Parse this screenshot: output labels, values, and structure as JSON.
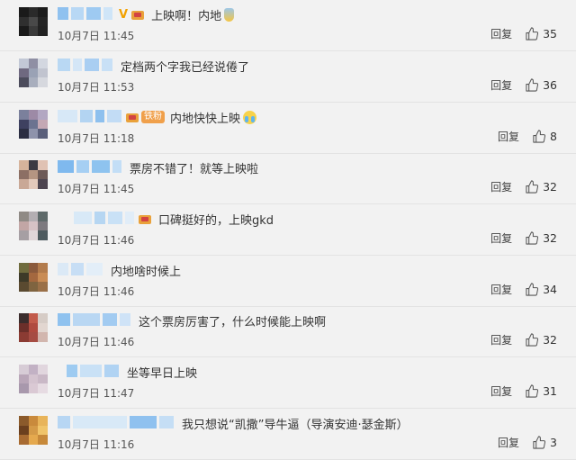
{
  "comments": [
    {
      "text": "上映啊！内地",
      "time": "10月7日 11:45",
      "reply_label": "回复",
      "likes": "35",
      "has_vip": true,
      "vip_label": "V",
      "emoji": "bottle-emoji",
      "avatar_colors": [
        "#1a1a1a",
        "#2a2a2a",
        "#1c1c1c",
        "#2f2f2f",
        "#494949",
        "#242424",
        "#1a1a1a",
        "#3a3a3a",
        "#222222"
      ],
      "blur_colors": [
        "#8fc1ef",
        "#b8d8f5",
        "#9ecaf2",
        "#cfe5f8"
      ]
    },
    {
      "text": "定档两个字我已经说倦了",
      "time": "10月7日 11:53",
      "reply_label": "回复",
      "likes": "36",
      "avatar_colors": [
        "#c2c8d6",
        "#8f8fa4",
        "#d3d7e0",
        "#6f6980",
        "#9aa2b5",
        "#c1c4cf",
        "#4c4c5c",
        "#a8aebd",
        "#d6d8de"
      ],
      "blur_colors": [
        "#b9d8f3",
        "#d4e6f7",
        "#a9cef2",
        "#c8e0f6"
      ]
    },
    {
      "text": "内地快快上映",
      "time": "10月7日 11:18",
      "reply_label": "回复",
      "likes": "8",
      "fan_label": "铁粉",
      "emoji": "cry-emoji",
      "avatar_colors": [
        "#7b809c",
        "#9d8aa6",
        "#b2a7c2",
        "#3e4160",
        "#6c7390",
        "#c4a8b4",
        "#2b2e42",
        "#8e93ab",
        "#5a5f7a"
      ],
      "blur_colors": [
        "#d7e8f7",
        "#b3d4f2",
        "#8ec0ee",
        "#c2dcf5"
      ]
    },
    {
      "text": "票房不错了！就等上映啦",
      "time": "10月7日 11:45",
      "reply_label": "回复",
      "likes": "32",
      "avatar_colors": [
        "#d6b39b",
        "#3d3a42",
        "#e0c2b3",
        "#8c6f64",
        "#b59582",
        "#6d5a57",
        "#c9a896",
        "#e2c9bb",
        "#4d4550"
      ],
      "blur_colors": [
        "#7fb9ee",
        "#a6cff3",
        "#8ec3ef",
        "#c3def6"
      ]
    },
    {
      "text": "口碑挺好的，上映gkd",
      "time": "10月7日 11:46",
      "reply_label": "回复",
      "likes": "32",
      "avatar_colors": [
        "#8f8a85",
        "#b3aeb2",
        "#5e6a6a",
        "#c2a6a5",
        "#d6c2c5",
        "#7d7a7f",
        "#a69fa3",
        "#e0d6d8",
        "#4e5b5f"
      ],
      "blur_colors": [
        "#d8e9f7",
        "#b6d6f2",
        "#c9e1f6",
        "#e1edf8"
      ]
    },
    {
      "text": "内地啥时候上",
      "time": "10月7日 11:46",
      "reply_label": "回复",
      "likes": "34",
      "avatar_colors": [
        "#6f6b3d",
        "#8a5a3c",
        "#b27b4c",
        "#3d3a28",
        "#a4683f",
        "#c98c55",
        "#5a4a30",
        "#7f6440",
        "#9a7048"
      ],
      "blur_colors": [
        "#dbe9f6",
        "#c7def5",
        "#e3eef8"
      ]
    },
    {
      "text": "这个票房厉害了，什么时候能上映啊",
      "time": "10月7日 11:46",
      "reply_label": "回复",
      "likes": "32",
      "avatar_colors": [
        "#3a2c2c",
        "#c25a4a",
        "#d6ccc6",
        "#6b2f2a",
        "#b04a3f",
        "#e2d6d0",
        "#8b3b33",
        "#a64c43",
        "#d2b6ae"
      ],
      "blur_colors": [
        "#8fc2ef",
        "#b9d7f3",
        "#a2cbf1",
        "#cfe3f7"
      ]
    },
    {
      "text": "坐等早日上映",
      "time": "10月7日 11:47",
      "reply_label": "回复",
      "likes": "31",
      "avatar_colors": [
        "#d7ccd6",
        "#c2b1c4",
        "#e1d6de",
        "#b9a6b8",
        "#d4c3cf",
        "#c9b8c6",
        "#a898ac",
        "#dac9d4",
        "#e6dbe2"
      ],
      "blur_colors": [
        "#9ecbf1",
        "#c9e1f6",
        "#b0d3f3"
      ]
    },
    {
      "text": "我只想说“凯撒”导牛逼（导演安迪·瑟金斯）",
      "time": "10月7日 11:16",
      "reply_label": "回复",
      "likes": "3",
      "avatar_colors": [
        "#8b5a2b",
        "#c98a3c",
        "#e8b45a",
        "#6b3f1e",
        "#d49a48",
        "#f0c46a",
        "#a86b32",
        "#e5a94e",
        "#c7893a"
      ],
      "blur_colors": [
        "#b7d6f3",
        "#d8e9f7",
        "#8fc1ef",
        "#c5def5"
      ]
    }
  ]
}
